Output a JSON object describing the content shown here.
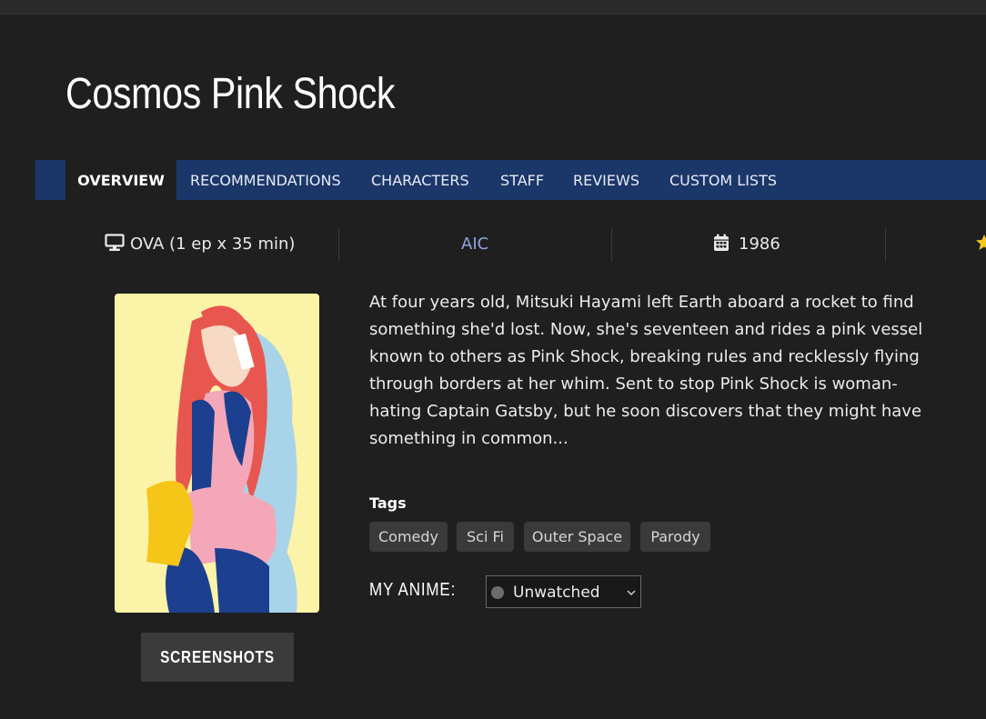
{
  "title": "Cosmos Pink Shock",
  "tabs": [
    {
      "label": "OVERVIEW",
      "active": true
    },
    {
      "label": "RECOMMENDATIONS",
      "active": false
    },
    {
      "label": "CHARACTERS",
      "active": false
    },
    {
      "label": "STAFF",
      "active": false
    },
    {
      "label": "REVIEWS",
      "active": false
    },
    {
      "label": "CUSTOM LISTS",
      "active": false
    }
  ],
  "info": {
    "format": "OVA (1 ep x 35 min)",
    "format_icon": "monitor-icon",
    "studio": "AIC",
    "year": "1986",
    "year_icon": "calendar-icon",
    "rating_icon": "star-icon"
  },
  "synopsis": "At four years old, Mitsuki Hayami left Earth aboard a rocket to find something she'd lost. Now, she's seventeen and rides a pink vessel known to others as Pink Shock, breaking rules and recklessly flying through borders at her whim. Sent to stop Pink Shock is woman-hating Captain Gatsby, but he soon discovers that they might have something in common...",
  "tags_label": "Tags",
  "tags": [
    "Comedy",
    "Sci Fi",
    "Outer Space",
    "Parody"
  ],
  "my_anime": {
    "label": "MY ANIME:",
    "status": "Unwatched"
  },
  "screenshots_label": "SCREENSHOTS",
  "colors": {
    "background": "#1f1f1f",
    "nav": "#1b3668",
    "studio_link": "#8fa3d8",
    "tag_bg": "#3a3a3a"
  }
}
